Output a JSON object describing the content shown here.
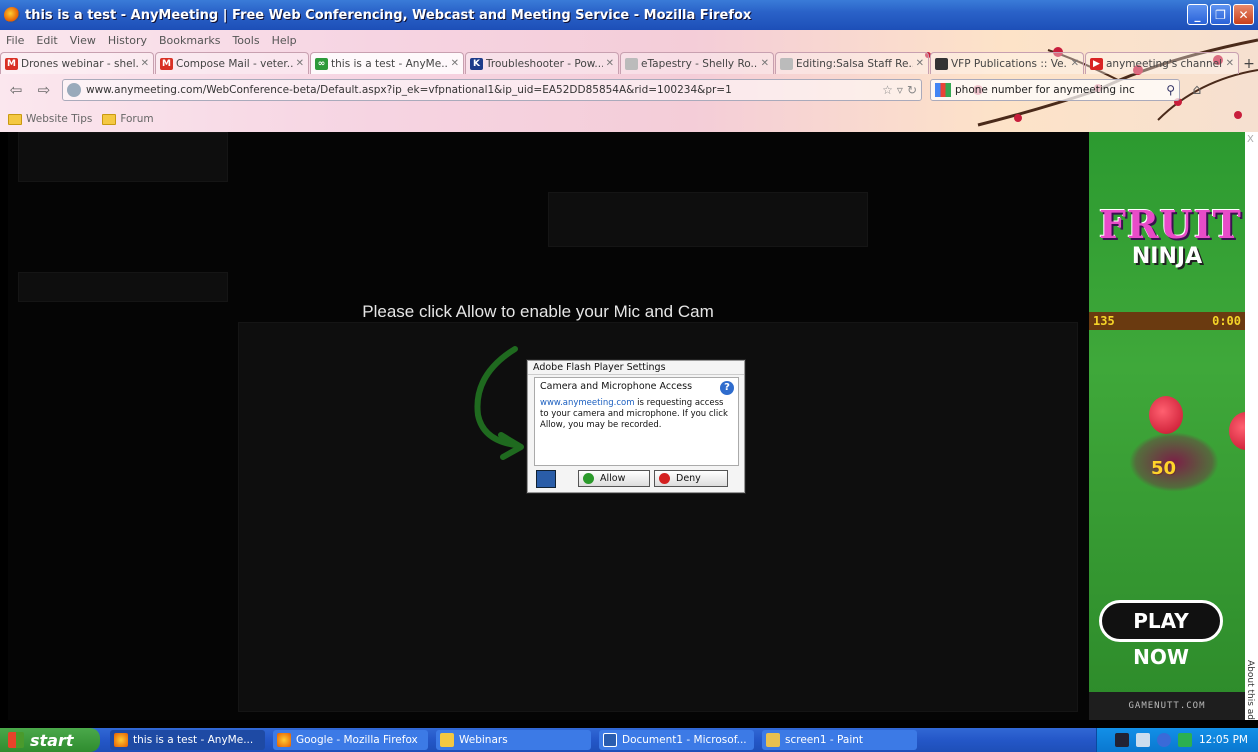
{
  "window": {
    "title": "this is a test - AnyMeeting | Free Web Conferencing, Webcast and Meeting Service - Mozilla Firefox"
  },
  "menu": [
    "File",
    "Edit",
    "View",
    "History",
    "Bookmarks",
    "Tools",
    "Help"
  ],
  "tabs": [
    {
      "label": "Drones webinar - shel...",
      "icon": "gmail-icon",
      "color": "#d93025"
    },
    {
      "label": "Compose Mail - veter...",
      "icon": "gmail-icon",
      "color": "#d93025"
    },
    {
      "label": "this is a test - AnyMe...",
      "icon": "anymeeting-icon",
      "color": "#2d9a3a",
      "active": true
    },
    {
      "label": "Troubleshooter - Pow...",
      "icon": "k-icon",
      "color": "#1d3c8a"
    },
    {
      "label": "eTapestry - Shelly Ro...",
      "icon": "page-icon",
      "color": "#bbbbbb"
    },
    {
      "label": "Editing:Salsa Staff Re...",
      "icon": "page-icon",
      "color": "#bbbbbb"
    },
    {
      "label": "VFP Publications :: Ve...",
      "icon": "vfp-icon",
      "color": "#333333"
    },
    {
      "label": "anymeeting's channel...",
      "icon": "youtube-icon",
      "color": "#d92323"
    }
  ],
  "nav": {
    "url": "www.anymeeting.com/WebConference-beta/Default.aspx?ip_ek=vfpnational1&ip_uid=EA52DD85854A&rid=100234&pr=1",
    "search_value": "phone number for anymeeting inc"
  },
  "bookmarks": [
    "Website Tips",
    "Forum"
  ],
  "main": {
    "prompt": "Please click Allow to enable your Mic and Cam"
  },
  "flash": {
    "header": "Adobe Flash Player Settings",
    "title": "Camera and Microphone Access",
    "site": "www.anymeeting.com",
    "body_rest": " is requesting access to your camera and microphone. If you click Allow, you may be recorded.",
    "allow_label": "Allow",
    "deny_label": "Deny"
  },
  "ad": {
    "logo_line1": "FRUIT",
    "logo_line2": "NINJA",
    "score": "135",
    "time": "0:00",
    "combo": "50",
    "cta": "PLAY NOW",
    "footer": "GAMENUTT.COM",
    "about": "About this ad",
    "close": "X"
  },
  "taskbar": {
    "start": "start",
    "tasks": [
      {
        "label": "this is a test - AnyMe...",
        "icon": "firefox-icon",
        "active": true
      },
      {
        "label": "Google - Mozilla Firefox",
        "icon": "firefox-icon"
      },
      {
        "label": "Webinars",
        "icon": "folder-icon"
      },
      {
        "label": "Document1 - Microsof...",
        "icon": "word-icon"
      },
      {
        "label": "screen1 - Paint",
        "icon": "paint-icon"
      }
    ],
    "clock": "12:05 PM"
  }
}
